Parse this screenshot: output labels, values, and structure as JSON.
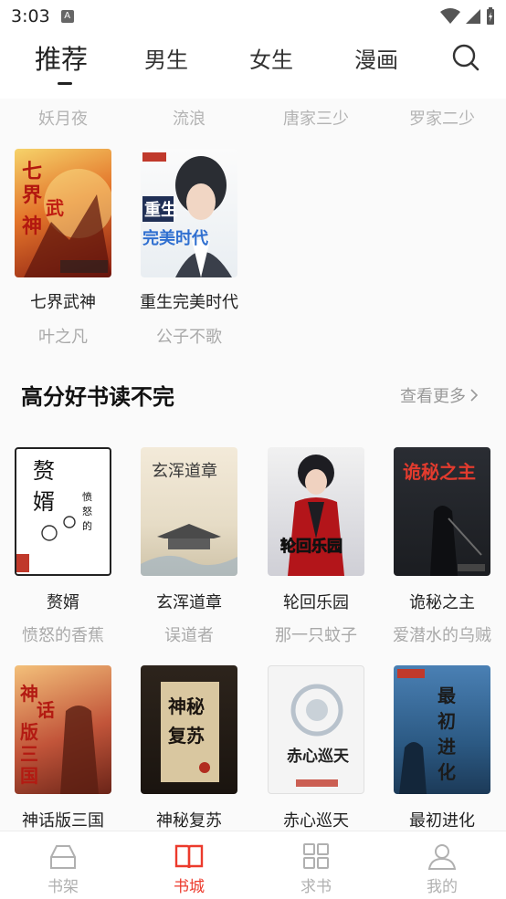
{
  "status_bar": {
    "time": "3:03",
    "notification_icon": "A"
  },
  "top_tabs": [
    {
      "label": "推荐",
      "active": true
    },
    {
      "label": "男生",
      "active": false
    },
    {
      "label": "女生",
      "active": false
    },
    {
      "label": "漫画",
      "active": false
    }
  ],
  "partial_row_authors": [
    "妖月夜",
    "流浪",
    "唐家三少",
    "罗家二少"
  ],
  "row1_books": [
    {
      "title": "七界武神",
      "author": "叶之凡",
      "cover_text": "七界武神"
    },
    {
      "title": "重生完美时代",
      "author": "公子不歌",
      "cover_text": "重生完美时代"
    }
  ],
  "section": {
    "title": "高分好书读不完",
    "more": "查看更多"
  },
  "section_books_row1": [
    {
      "title": "赘婿",
      "author": "愤怒的香蕉",
      "cover_text": "赘婿"
    },
    {
      "title": "玄浑道章",
      "author": "误道者",
      "cover_text": "玄浑道章"
    },
    {
      "title": "轮回乐园",
      "author": "那一只蚊子",
      "cover_text": "轮回乐园"
    },
    {
      "title": "诡秘之主",
      "author": "爱潜水的乌贼",
      "cover_text": "诡秘之主"
    }
  ],
  "section_books_row2": [
    {
      "title": "神话版三国",
      "cover_text": "神话版三国"
    },
    {
      "title": "神秘复苏",
      "cover_text": "神秘复苏"
    },
    {
      "title": "赤心巡天",
      "cover_text": "赤心巡天"
    },
    {
      "title": "最初进化",
      "cover_text": "最初进化"
    }
  ],
  "bottom_nav": [
    {
      "label": "书架",
      "icon": "bookshelf-icon",
      "active": false
    },
    {
      "label": "书城",
      "icon": "book-store-icon",
      "active": true
    },
    {
      "label": "求书",
      "icon": "grid-icon",
      "active": false
    },
    {
      "label": "我的",
      "icon": "profile-icon",
      "active": false
    }
  ],
  "colors": {
    "accent": "#ec3a2c",
    "text": "#222222",
    "muted": "#a9a9a9"
  }
}
